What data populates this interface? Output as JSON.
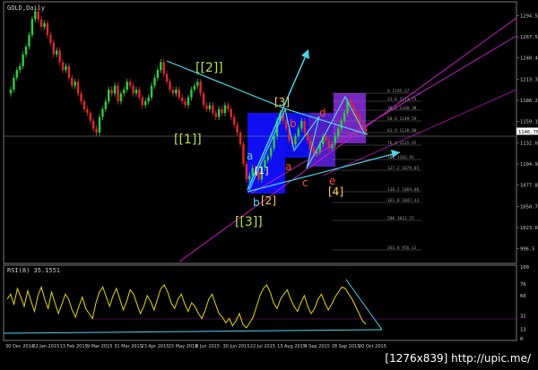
{
  "window": {
    "symbol_label": "GOLD,Daily"
  },
  "footer": {
    "caption": "[1276x839] http://upic.me/"
  },
  "colors": {
    "background": "#000000",
    "candle_up": "#2ecc40",
    "candle_down": "#e0282e",
    "wave_label_green": "#b5e04d",
    "wave_label_yellow": "#ffd23a",
    "wave_label_red": "#ff4a2a",
    "wave_label_cyan": "#5fd3ff",
    "trendline_cyan": "#49d6e8",
    "channel_magenta": "#c81ec8",
    "box_blue": "#1010ff",
    "box_purple": "#8a2be2",
    "rsi_line": "#e8d800",
    "fib_text": "#9a9a9a"
  },
  "chart_data": [
    {
      "type": "candlestick",
      "symbol": "GOLD",
      "timeframe": "Daily",
      "x_ticks": [
        "30 Dec 2014",
        "22 Jan 2015",
        "13 Feb 2015",
        "9 Mar 2015",
        "31 Mar 2015",
        "23 Apr 2015",
        "15 May 2015",
        "8 Jun 2015",
        "30 Jun 2015",
        "22 Jul 2015",
        "13 Aug 2015",
        "4 Sep 2015",
        "28 Sep 2015",
        "20 Oct 2015"
      ],
      "y_ticks": [
        1294.5,
        1267.5,
        1240.4,
        1213.3,
        1186.2,
        1159.1,
        1132.0,
        1104.9,
        1077.8,
        1050.7,
        1023.6,
        996.5
      ],
      "ylim": [
        980,
        1310
      ],
      "current_price": 1146.76,
      "closes": [
        1200,
        1215,
        1225,
        1230,
        1245,
        1255,
        1270,
        1290,
        1300,
        1290,
        1280,
        1285,
        1270,
        1260,
        1245,
        1250,
        1235,
        1225,
        1230,
        1215,
        1205,
        1210,
        1195,
        1185,
        1175,
        1170,
        1160,
        1150,
        1145,
        1165,
        1175,
        1185,
        1200,
        1195,
        1205,
        1185,
        1195,
        1200,
        1210,
        1205,
        1195,
        1200,
        1190,
        1180,
        1185,
        1190,
        1205,
        1215,
        1225,
        1235,
        1220,
        1210,
        1200,
        1195,
        1200,
        1190,
        1185,
        1180,
        1190,
        1200,
        1205,
        1210,
        1195,
        1180,
        1175,
        1180,
        1170,
        1165,
        1175,
        1170,
        1180,
        1175,
        1165,
        1155,
        1145,
        1130,
        1105,
        1085,
        1090,
        1100,
        1095,
        1085,
        1100,
        1110,
        1115,
        1125,
        1140,
        1160,
        1170,
        1160,
        1150,
        1135,
        1130,
        1140,
        1150,
        1160,
        1145,
        1135,
        1125,
        1118,
        1120,
        1130,
        1140,
        1135,
        1125,
        1130,
        1140,
        1150,
        1160,
        1170,
        1185,
        1180,
        1170,
        1165,
        1155,
        1150,
        1146
      ]
    },
    {
      "type": "line",
      "indicator_label": "RSI(8) 35.1551",
      "y_ticks": [
        100,
        76,
        60,
        32,
        13,
        0
      ],
      "ylim": [
        0,
        100
      ],
      "values": [
        55,
        62,
        48,
        70,
        58,
        45,
        67,
        52,
        38,
        60,
        72,
        55,
        42,
        65,
        50,
        35,
        48,
        62,
        55,
        40,
        30,
        45,
        58,
        42,
        35,
        28,
        50,
        65,
        72,
        58,
        45,
        60,
        70,
        55,
        40,
        52,
        68,
        62,
        48,
        35,
        45,
        60,
        52,
        40,
        55,
        70,
        75,
        65,
        50,
        42,
        55,
        62,
        48,
        38,
        50,
        45,
        35,
        28,
        40,
        55,
        62,
        48,
        35,
        30,
        22,
        28,
        18,
        25,
        35,
        20,
        15,
        22,
        30,
        45,
        60,
        70,
        75,
        65,
        50,
        42,
        55,
        62,
        68,
        55,
        45,
        38,
        50,
        60,
        45,
        35,
        42,
        55,
        62,
        50,
        40,
        48,
        58,
        65,
        72,
        70,
        62,
        55,
        45,
        35,
        25,
        20
      ]
    }
  ],
  "wave_labels": [
    {
      "text": "[[2]]",
      "color": "wave_label_green"
    },
    {
      "text": "[[1]]",
      "color": "wave_label_green"
    },
    {
      "text": "[3]",
      "color": "wave_label_yellow"
    },
    {
      "text": "a",
      "color": "wave_label_cyan"
    },
    {
      "text": "[1]",
      "color": "wave_label_cyan"
    },
    {
      "text": "b",
      "color": "wave_label_cyan"
    },
    {
      "text": "[2]",
      "color": "wave_label_yellow"
    },
    {
      "text": "[[3]]",
      "color": "wave_label_green"
    },
    {
      "text": "b",
      "color": "wave_label_red"
    },
    {
      "text": "a",
      "color": "wave_label_red"
    },
    {
      "text": "c",
      "color": "wave_label_red"
    },
    {
      "text": "d",
      "color": "wave_label_red"
    },
    {
      "text": "e",
      "color": "wave_label_red"
    },
    {
      "text": "[4]",
      "color": "wave_label_yellow"
    }
  ],
  "fib_levels": [
    "0 1195.27",
    "23.6 1173.73",
    "38.2 1160.38",
    "50.0 1149.59",
    "61.8 1138.80",
    "76.4 1125.45",
    "100 1103.91",
    "127.2 1079.05",
    "138.2 1069.00",
    "161.8 1047.43",
    "200 1012.55",
    "261.8 956.11"
  ]
}
